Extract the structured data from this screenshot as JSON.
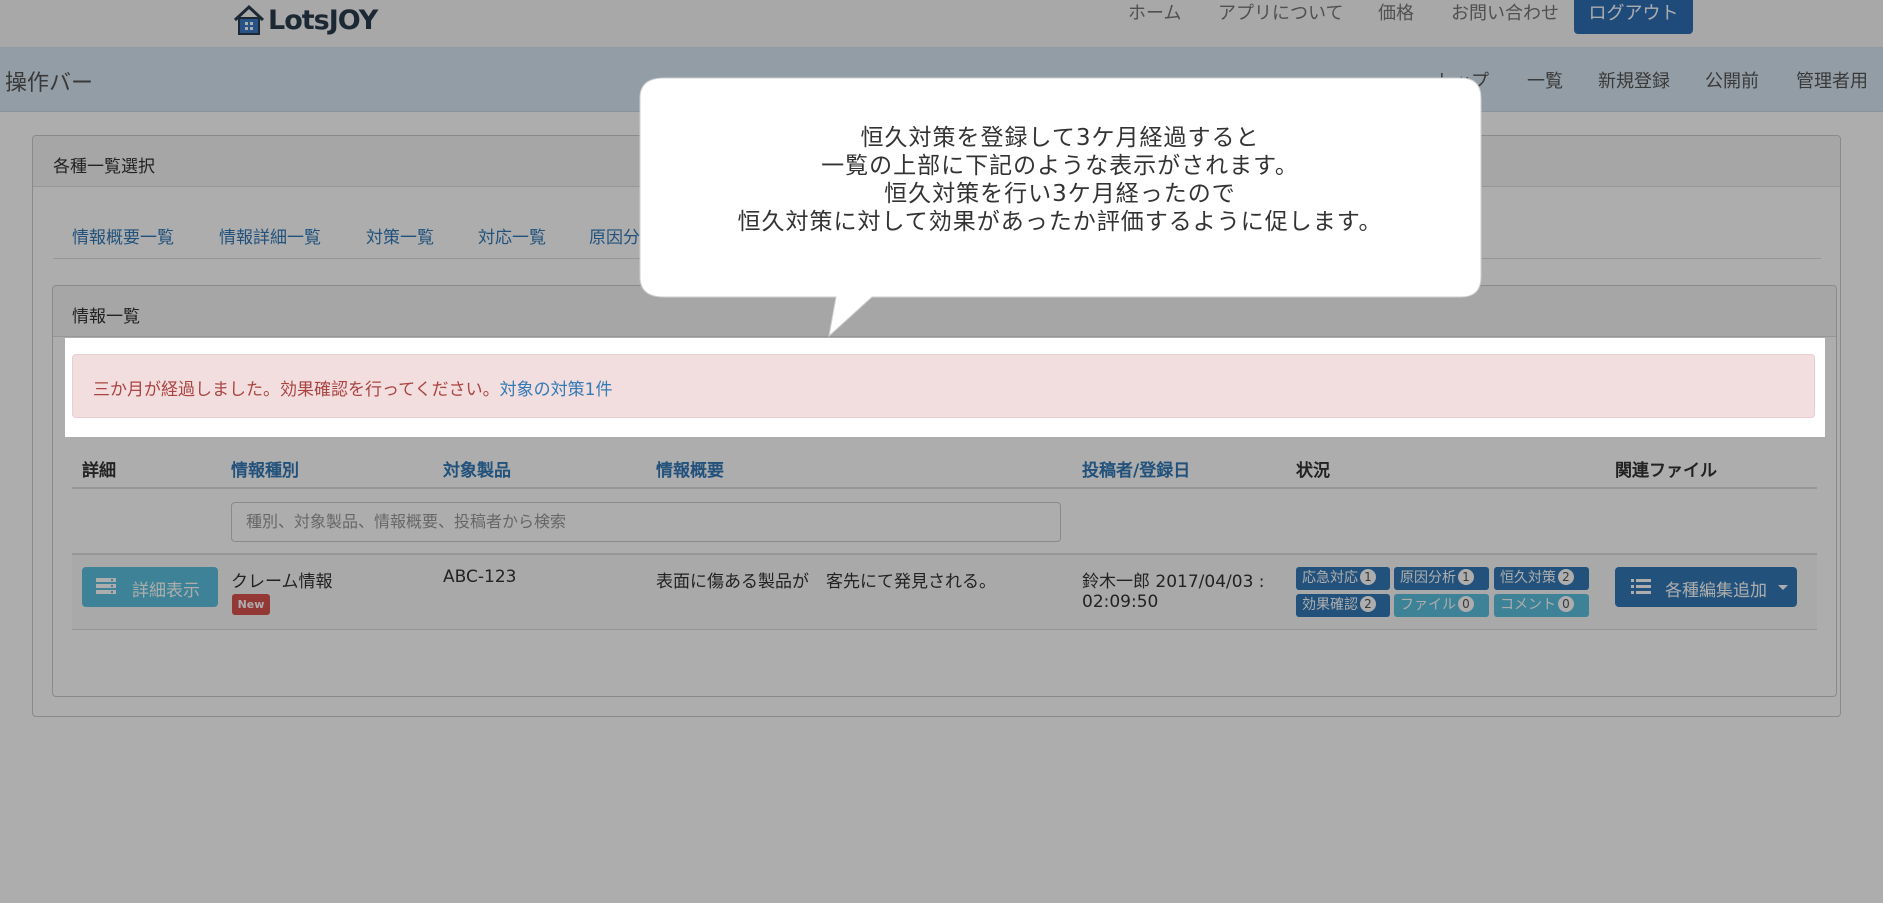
{
  "navbar": {
    "brand": "LotsJOY",
    "links": [
      "ホーム",
      "アプリについて",
      "価格",
      "お問い合わせ"
    ],
    "logout": "ログアウト"
  },
  "actionbar": {
    "title": "操作バー",
    "links": [
      "トップ",
      "一覧",
      "新規登録",
      "公開前",
      "管理者用"
    ]
  },
  "list_select": {
    "title": "各種一覧選択",
    "tabs": [
      "情報概要一覧",
      "情報詳細一覧",
      "対策一覧",
      "対応一覧",
      "原因分"
    ]
  },
  "info_list": {
    "title": "情報一覧",
    "alert": {
      "text": "三か月が経過しました。効果確認を行ってください。",
      "link": "対象の対策1件"
    },
    "columns": [
      "詳細",
      "情報種別",
      "対象製品",
      "情報概要",
      "投稿者/登録日",
      "状況",
      "関連ファイル"
    ],
    "search_placeholder": "種別、対象製品、情報概要、投稿者から検索",
    "rows": [
      {
        "detail_button": "詳細表示",
        "type": "クレーム情報",
        "badge": "New",
        "product": "ABC-123",
        "summary": "表面に傷ある製品が　客先にて発見される。",
        "poster": "鈴木一郎 2017/04/03 :",
        "time": "02:09:50",
        "status_tags": [
          {
            "label": "応急対応",
            "count": "1"
          },
          {
            "label": "原因分析",
            "count": "1"
          },
          {
            "label": "恒久対策",
            "count": "2"
          },
          {
            "label": "効果確認",
            "count": "2"
          },
          {
            "label": "ファイル",
            "count": "0"
          },
          {
            "label": "コメント",
            "count": "0"
          }
        ],
        "edit_button": "各種編集追加"
      }
    ]
  },
  "callout": {
    "lines": [
      "恒久対策を登録して3ケ月経過すると",
      "一覧の上部に下記のような表示がされます。",
      "恒久対策を行い3ケ月経ったので",
      "恒久対策に対して効果があったか評価するように促します。"
    ]
  },
  "colors": {
    "primary": "#337ab7",
    "info": "#5bc0de",
    "danger": "#d9534f",
    "alert_bg": "#f2dede",
    "alert_text": "#a94442",
    "dim_overlay": "#000000"
  }
}
